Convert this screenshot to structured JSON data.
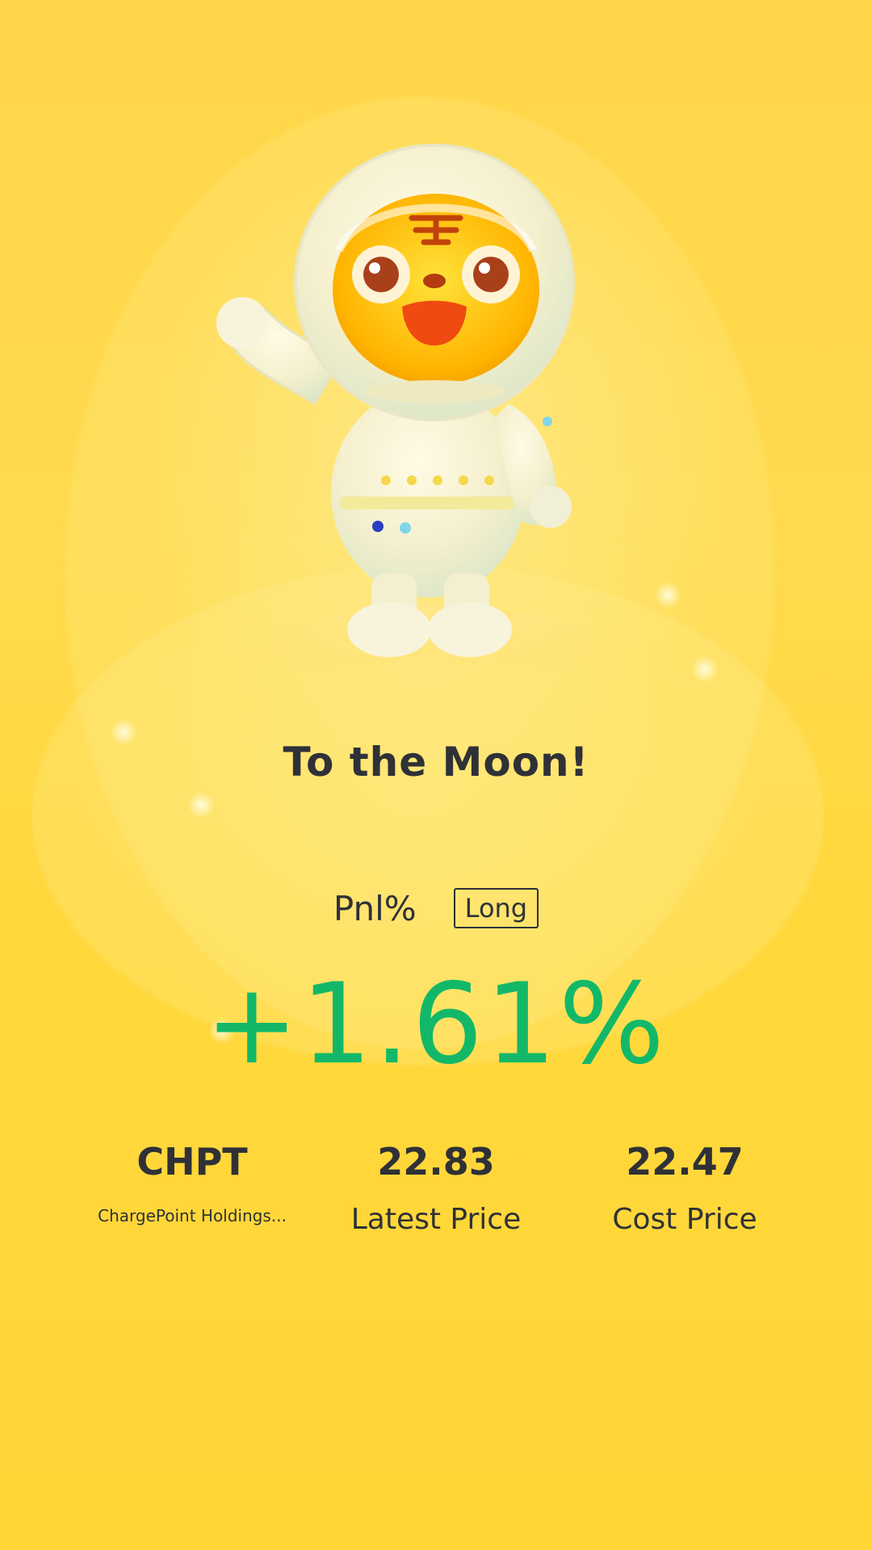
{
  "card": {
    "title": "To the Moon!",
    "pnl_label": "Pnl%",
    "position_badge": "Long",
    "pnl_value": "+1.61%",
    "pnl_color": "#12b868",
    "background_color": "#ffd83c"
  },
  "mascot": {
    "icon": "astronaut-tiger-mascot"
  },
  "stats": [
    {
      "value": "CHPT",
      "label": "ChargePoint Holdings..."
    },
    {
      "value": "22.83",
      "label": "Latest Price"
    },
    {
      "value": "22.47",
      "label": "Cost Price"
    }
  ]
}
